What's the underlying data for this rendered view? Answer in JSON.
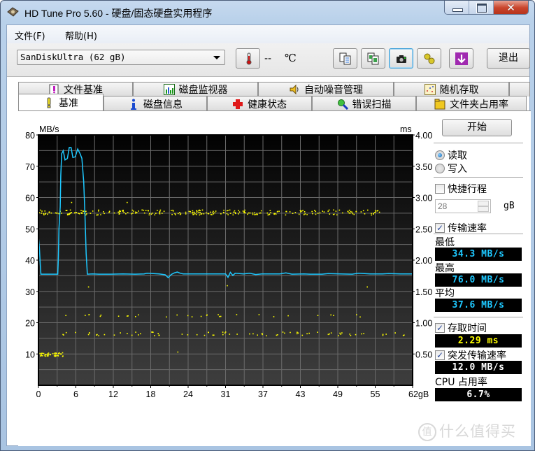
{
  "window": {
    "title": "HD Tune Pro 5.60 - 硬盘/固态硬盘实用程序",
    "controls": {
      "minimize": "minimize",
      "maximize": "maximize",
      "close": "✕"
    }
  },
  "menu": [
    {
      "label": "文件(F)"
    },
    {
      "label": "帮助(H)"
    }
  ],
  "toolbar": {
    "drive": "SanDiskUltra (62 gB)",
    "temperature_value": "--",
    "temperature_unit": "℃",
    "buttons": [
      {
        "name": "copy-text",
        "icon": "copy-text-icon"
      },
      {
        "name": "copy-screenshot",
        "icon": "copy-image-icon"
      },
      {
        "name": "screenshot",
        "icon": "camera-icon"
      },
      {
        "name": "options",
        "icon": "options-icon"
      },
      {
        "name": "download",
        "icon": "download-icon"
      }
    ],
    "exit_label": "退出"
  },
  "tabs": {
    "back_row": [
      {
        "label": "文件基准",
        "icon": "file-benchmark-icon"
      },
      {
        "label": "磁盘监视器",
        "icon": "disk-monitor-icon"
      },
      {
        "label": "自动噪音管理",
        "icon": "speaker-icon"
      },
      {
        "label": "随机存取",
        "icon": "random-access-icon"
      },
      {
        "label": "",
        "icon": ""
      }
    ],
    "front_row": [
      {
        "label": "基准",
        "icon": "benchmark-icon",
        "active": true
      },
      {
        "label": "磁盘信息",
        "icon": "info-icon"
      },
      {
        "label": "健康状态",
        "icon": "health-icon"
      },
      {
        "label": "错误扫描",
        "icon": "magnifier-icon"
      },
      {
        "label": "文件夹占用率",
        "icon": "folder-icon"
      }
    ]
  },
  "side": {
    "start_label": "开始",
    "read_label": "读取",
    "write_label": "写入",
    "read_selected": true,
    "short_stroke_label": "快捷行程",
    "short_stroke_checked": false,
    "short_stroke_value": "28",
    "short_stroke_unit": "gB",
    "transfer_rate_label": "传输速率",
    "transfer_rate_checked": true,
    "min_label": "最低",
    "min_value": "34.3 MB/s",
    "max_label": "最高",
    "max_value": "76.0 MB/s",
    "avg_label": "平均",
    "avg_value": "37.6 MB/s",
    "access_time_label": "存取时间",
    "access_time_checked": true,
    "access_time_value": "2.29 ms",
    "burst_label": "突发传输速率",
    "burst_checked": true,
    "burst_value": "12.0 MB/s",
    "cpu_label": "CPU 占用率",
    "cpu_value": "6.7%",
    "colors": {
      "mbs": "#1ec8ff",
      "ms": "#ffff00"
    }
  },
  "watermark": {
    "circle": "值",
    "text": "什么值得买"
  },
  "chart_data": {
    "type": "line",
    "title": "",
    "xlabel": "gB",
    "ylabel": "MB/s",
    "y2label": "ms",
    "xlim": [
      0,
      62
    ],
    "ylim": [
      0,
      80
    ],
    "y2lim": [
      0,
      4
    ],
    "x_ticks": [
      "0",
      "6",
      "12",
      "18",
      "24",
      "31",
      "37",
      "43",
      "49",
      "55",
      "62gB"
    ],
    "x_tick_values": [
      0,
      6,
      12,
      18,
      24,
      31,
      37,
      43,
      49,
      55,
      62
    ],
    "y_ticks": [
      10,
      20,
      30,
      40,
      50,
      60,
      70,
      80
    ],
    "y2_ticks": [
      "0.50",
      "1.00",
      "1.50",
      "2.00",
      "2.50",
      "3.00",
      "3.50",
      "4.00"
    ],
    "grid": true,
    "background": "dark-gradient",
    "series": [
      {
        "name": "Transfer rate (MB/s)",
        "color": "#1ec8ff",
        "axis": "left",
        "points": [
          [
            0,
            47.5
          ],
          [
            0.15,
            44
          ],
          [
            0.3,
            38.5
          ],
          [
            0.4,
            35.5
          ],
          [
            3.2,
            35.5
          ],
          [
            3.3,
            41
          ],
          [
            3.4,
            50
          ],
          [
            3.6,
            57
          ],
          [
            3.7,
            67
          ],
          [
            3.85,
            74
          ],
          [
            4.1,
            75
          ],
          [
            4.4,
            72
          ],
          [
            4.8,
            72.5
          ],
          [
            5.1,
            76
          ],
          [
            5.4,
            76
          ],
          [
            5.7,
            72.8
          ],
          [
            6.1,
            73
          ],
          [
            6.5,
            75.5
          ],
          [
            6.9,
            74
          ],
          [
            7.2,
            72.5
          ],
          [
            7.5,
            65
          ],
          [
            7.7,
            55
          ],
          [
            7.9,
            42
          ],
          [
            8.1,
            35.5
          ],
          [
            9,
            35.6
          ],
          [
            10,
            35.5
          ],
          [
            12,
            35.5
          ],
          [
            14,
            35.6
          ],
          [
            16,
            35.5
          ],
          [
            17.5,
            35.6
          ],
          [
            18,
            35.8
          ],
          [
            19,
            35.7
          ],
          [
            20,
            35.6
          ],
          [
            21,
            35.3
          ],
          [
            21.5,
            34.4
          ],
          [
            22,
            35.4
          ],
          [
            22.5,
            35.9
          ],
          [
            23,
            36.2
          ],
          [
            23.5,
            35.8
          ],
          [
            24,
            35.6
          ],
          [
            26,
            35.6
          ],
          [
            28,
            35.6
          ],
          [
            31,
            35.6
          ],
          [
            31.4,
            34.5
          ],
          [
            31.8,
            36.1
          ],
          [
            32.2,
            35.1
          ],
          [
            32.6,
            35.8
          ],
          [
            34,
            35.6
          ],
          [
            35,
            35.8
          ],
          [
            36,
            35.4
          ],
          [
            37,
            35.6
          ],
          [
            40,
            35.6
          ],
          [
            41,
            35.9
          ],
          [
            42,
            35.5
          ],
          [
            44,
            35.6
          ],
          [
            45,
            35.5
          ],
          [
            47,
            35.5
          ],
          [
            48,
            35.7
          ],
          [
            50,
            35.6
          ],
          [
            52,
            35.5
          ],
          [
            53,
            35.8
          ],
          [
            55,
            35.6
          ],
          [
            57,
            35.6
          ],
          [
            58,
            35.7
          ],
          [
            60,
            35.6
          ],
          [
            62,
            35.6
          ]
        ]
      },
      {
        "name": "Access time (ms)",
        "color": "#ffff00",
        "axis": "right",
        "style": "scatter",
        "clusters": [
          {
            "x_range": [
              0,
              58
            ],
            "y_center": 2.77,
            "y_spread": 0.04,
            "count": 260
          },
          {
            "x_range": [
              0,
              4
            ],
            "y_center": 0.5,
            "y_spread": 0.03,
            "count": 45
          },
          {
            "x_range": [
              2.5,
              62
            ],
            "y_center": 0.83,
            "y_spread": 0.03,
            "count": 75
          },
          {
            "x_range": [
              3,
              55
            ],
            "y_center": 1.12,
            "y_spread": 0.02,
            "count": 30
          }
        ],
        "outliers": [
          [
            5.4,
            2.93
          ],
          [
            14.6,
            2.93
          ],
          [
            31.2,
            1.6
          ],
          [
            8.2,
            1.58
          ],
          [
            54.4,
            1.58
          ],
          [
            23.0,
            0.54
          ]
        ]
      }
    ]
  }
}
